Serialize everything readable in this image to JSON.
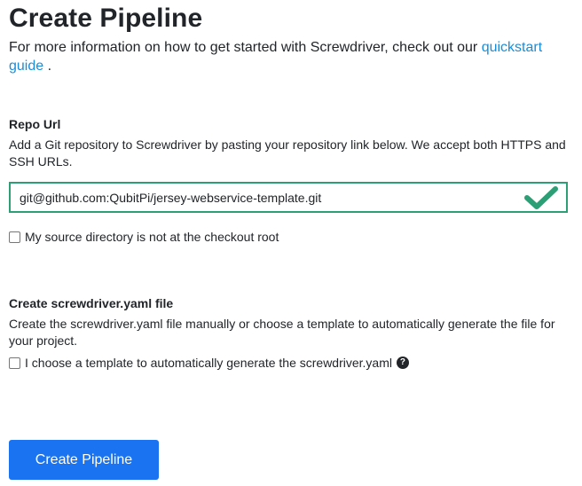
{
  "page": {
    "title": "Create Pipeline",
    "intro_text": "For more information on how to get started with Screwdriver, check out our ",
    "intro_link": "quickstart guide",
    "intro_end": " ."
  },
  "repo": {
    "heading": "Repo Url",
    "help": "Add a Git repository to Screwdriver by pasting your repository link below. We accept both HTTPS and SSH URLs.",
    "input_value": "git@github.com:QubitPi/jersey-webservice-template.git",
    "valid_icon": "checkmark-icon",
    "checkbox_label": "My source directory is not at the checkout root",
    "checkbox_checked": false
  },
  "yaml": {
    "heading": "Create screwdriver.yaml file",
    "help": "Create the screwdriver.yaml file manually or choose a template to automatically generate the file for your project.",
    "checkbox_label": "I choose a template to automatically generate the screwdriver.yaml",
    "checkbox_checked": false,
    "help_icon": "question-circle-icon"
  },
  "actions": {
    "create_label": "Create Pipeline"
  },
  "colors": {
    "accent": "#1a73f0",
    "link": "#1a8cd8",
    "valid": "#2d9f77"
  }
}
